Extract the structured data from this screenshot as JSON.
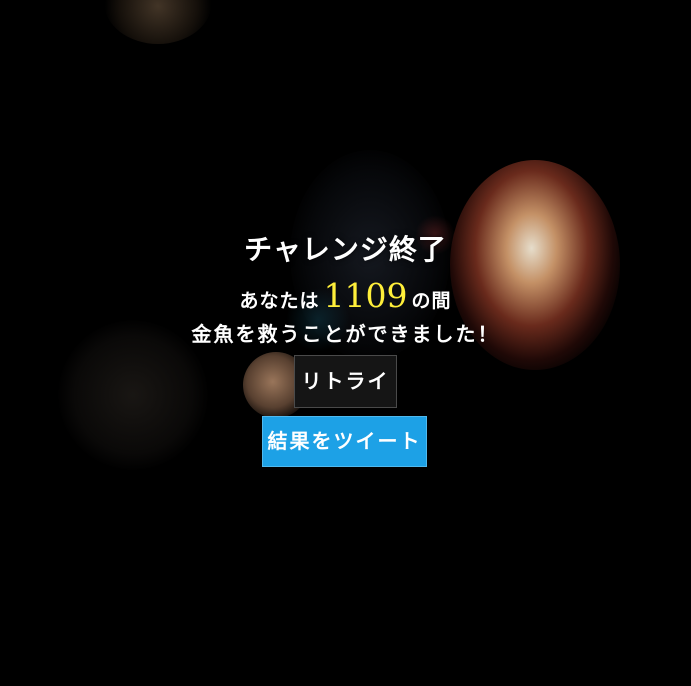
{
  "result": {
    "title": "チャレンジ終了",
    "prefix": "あなたは",
    "score": "1109",
    "suffix": "の間",
    "message": "金魚を救うことができました！"
  },
  "buttons": {
    "retry_label": "リトライ",
    "tweet_label": "結果をツイート"
  },
  "colors": {
    "background": "#000000",
    "score": "#ffef3a",
    "tweet_button": "#1da1e6",
    "retry_button": "#151515"
  }
}
